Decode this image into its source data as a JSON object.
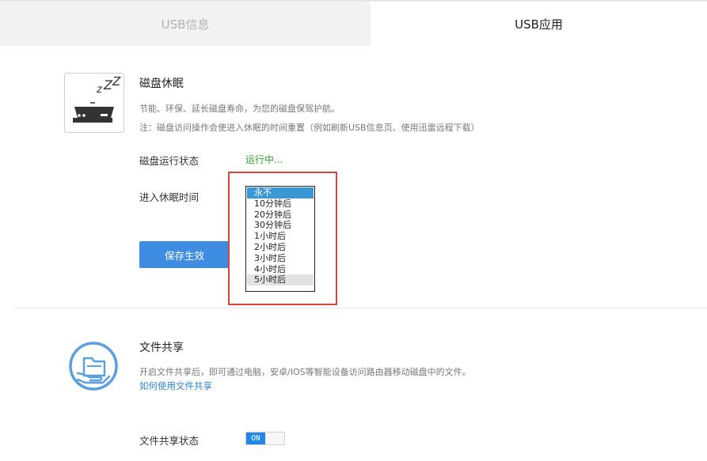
{
  "tabs": [
    {
      "label": "USB信息"
    },
    {
      "label": "USB应用"
    }
  ],
  "disk_sleep": {
    "icon": "hard-disk-sleep-icon",
    "title": "磁盘休眠",
    "desc": "节能、环保、延长磁盘寿命，为您的磁盘保驾护航。",
    "note": "注：磁盘访问操作会使进入休眠的时间重置（例如刷新USB信息页、使用迅雷远程下载）",
    "status_label": "磁盘运行状态",
    "status_value": "运行中...",
    "sleep_label": "进入休眠时间",
    "save_label": "保存生效",
    "options": [
      "永不",
      "10分钟后",
      "20分钟后",
      "30分钟后",
      "1小时后",
      "2小时后",
      "3小时后",
      "4小时后",
      "5小时后"
    ],
    "selected_option": "永不",
    "hovered_option": "5小时后"
  },
  "file_share": {
    "icon": "folder-hand-share-icon",
    "title": "文件共享",
    "desc": "开启文件共享后，即可通过电脑，安卓/IOS等智能设备访问路由器移动磁盘中的文件。",
    "link": "如何使用文件共享",
    "status_label": "文件共享状态",
    "toggle_label": "ON"
  },
  "colors": {
    "accent": "#3f8de2",
    "running": "#33a532",
    "highlight_frame": "#d9453b",
    "selected_option": "#3a97d8"
  }
}
